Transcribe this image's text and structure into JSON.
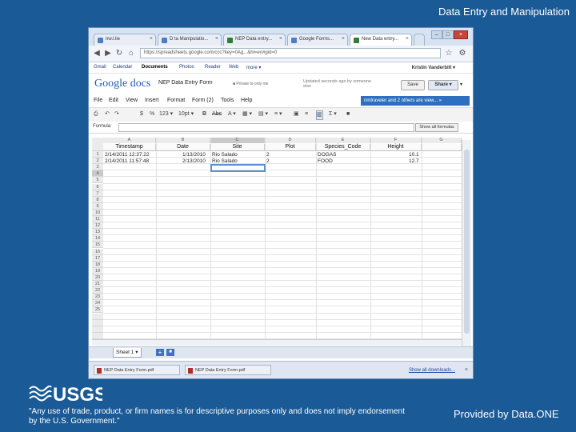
{
  "slide": {
    "title": "Data Entry and Manipulation",
    "disclaimer": "\"Any use of trade, product, or firm names is for descriptive purposes only and does not imply endorsement by the U.S. Government.\"",
    "provided_by": "Provided by Data.ONE",
    "logo_text": "USGS"
  },
  "browser": {
    "tabs": [
      {
        "label": "nw.l.lie"
      },
      {
        "label": "D ta Manipulatio..."
      },
      {
        "label": "NEP Data entry..."
      },
      {
        "label": "Google Forms..."
      },
      {
        "label": "New Data entry..."
      }
    ],
    "active_tab": 4,
    "url": "https://spreadsheets.google.com/ccc?key=0Ag...&hl=en#gid=0"
  },
  "google_bar": {
    "items": [
      "Gmail",
      "Calendar",
      "Documents",
      "Photos",
      "Reader",
      "Web",
      "more ▾"
    ],
    "active": "Documents",
    "user": "Kristin Vanderbilt ▾"
  },
  "docs": {
    "logo_google": "Google",
    "logo_docs": "docs",
    "doc_title": "NEP Data Entry Form",
    "status": "■ Private to only me",
    "autosave": "Updated seconds ago by someone else",
    "save_label": "Save",
    "share_label": "Share ▾"
  },
  "menus": [
    "File",
    "Edit",
    "View",
    "Insert",
    "Format",
    "Form (2)",
    "Tools",
    "Help"
  ],
  "viewers_text": "nmtraveler and 2 others are view... »",
  "toolbar": [
    "⎙",
    "↶",
    "↷",
    "$",
    "%",
    "123 ▾",
    "10pt ▾",
    "B",
    "Abc",
    "A ▾",
    "▦ ▾",
    "▤ ▾",
    "≡ ▾",
    "▣",
    "≡",
    "▥",
    "Σ ▾",
    "■"
  ],
  "formula": {
    "label": "Formula:",
    "value": "",
    "range_button": "Show all formulas"
  },
  "grid": {
    "col_letters": [
      "A",
      "B",
      "C",
      "D",
      "E",
      "F",
      "G"
    ],
    "headers": [
      "Timestamp",
      "Date",
      "Site",
      "Plot",
      "Species_Code",
      "Height",
      ""
    ],
    "row_numbers": [
      "1",
      "2",
      "3",
      "4",
      "5",
      "6",
      "7",
      "8",
      "9",
      "10",
      "11",
      "12",
      "13",
      "14",
      "15",
      "16",
      "17",
      "18",
      "19",
      "20",
      "21",
      "22",
      "23",
      "24",
      "25"
    ],
    "rows": [
      [
        "2/14/2011 12:37:22",
        "1/13/2010",
        "Rio Salado",
        "2",
        "DOGAS",
        "10.1"
      ],
      [
        "2/14/2011 11:57:48",
        "2/13/2010",
        "Rio Salado",
        "2",
        "FOOD",
        "12.7"
      ]
    ]
  },
  "sheets": {
    "active": "Sheet 1 ▾",
    "add": "+",
    "menu": "■"
  },
  "downloads": {
    "items": [
      "NEP Data Entry Form.pdf",
      "NEP Data Entry Form.pdf"
    ],
    "show_all": "Show all downloads...",
    "close": "×"
  },
  "colors": {
    "slide_bg": "#1a5a96",
    "selection": "#5b8fd4",
    "viewers_banner": "#2e6fbf"
  }
}
